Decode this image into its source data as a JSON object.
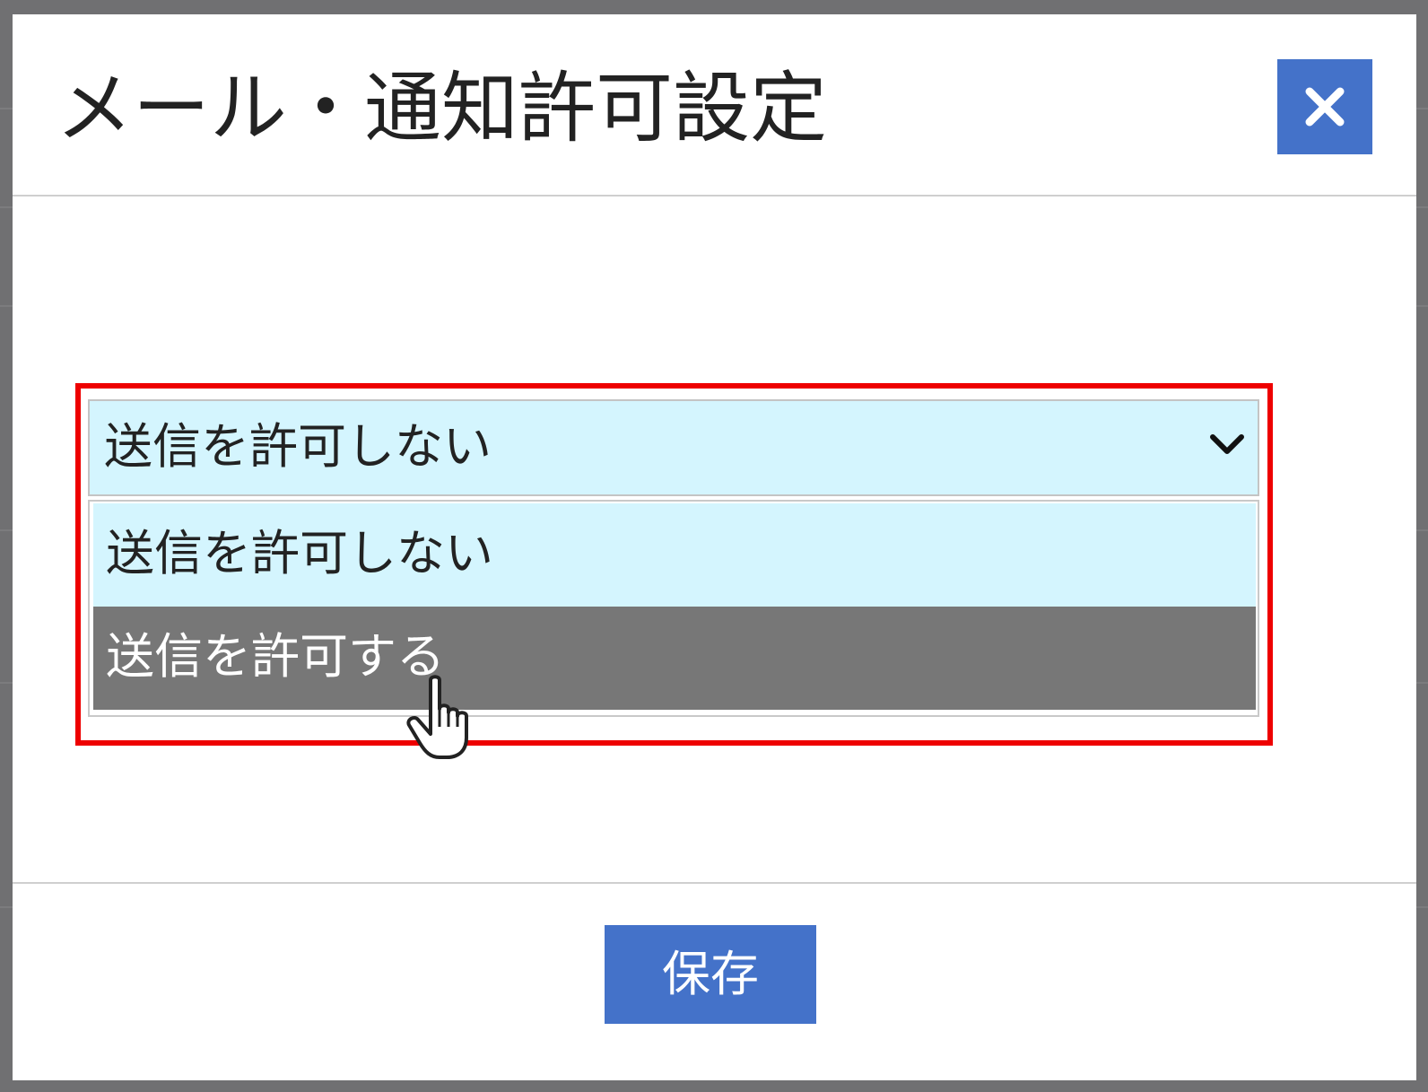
{
  "modal": {
    "title": "メール・通知許可設定",
    "close_icon": "close-icon"
  },
  "select": {
    "selected_value": "送信を許可しない",
    "chevron_icon": "chevron-down-icon",
    "options": [
      {
        "label": "送信を許可しない",
        "state": "selected"
      },
      {
        "label": "送信を許可する",
        "state": "hovered"
      }
    ]
  },
  "footer": {
    "save_label": "保存"
  },
  "colors": {
    "accent": "#4472c9",
    "option_bg": "#d4f5fe",
    "hover_bg": "#777777",
    "highlight": "#ee0000",
    "overlay": "#707072"
  },
  "pointer": {
    "icon": "hand-pointer-icon"
  }
}
